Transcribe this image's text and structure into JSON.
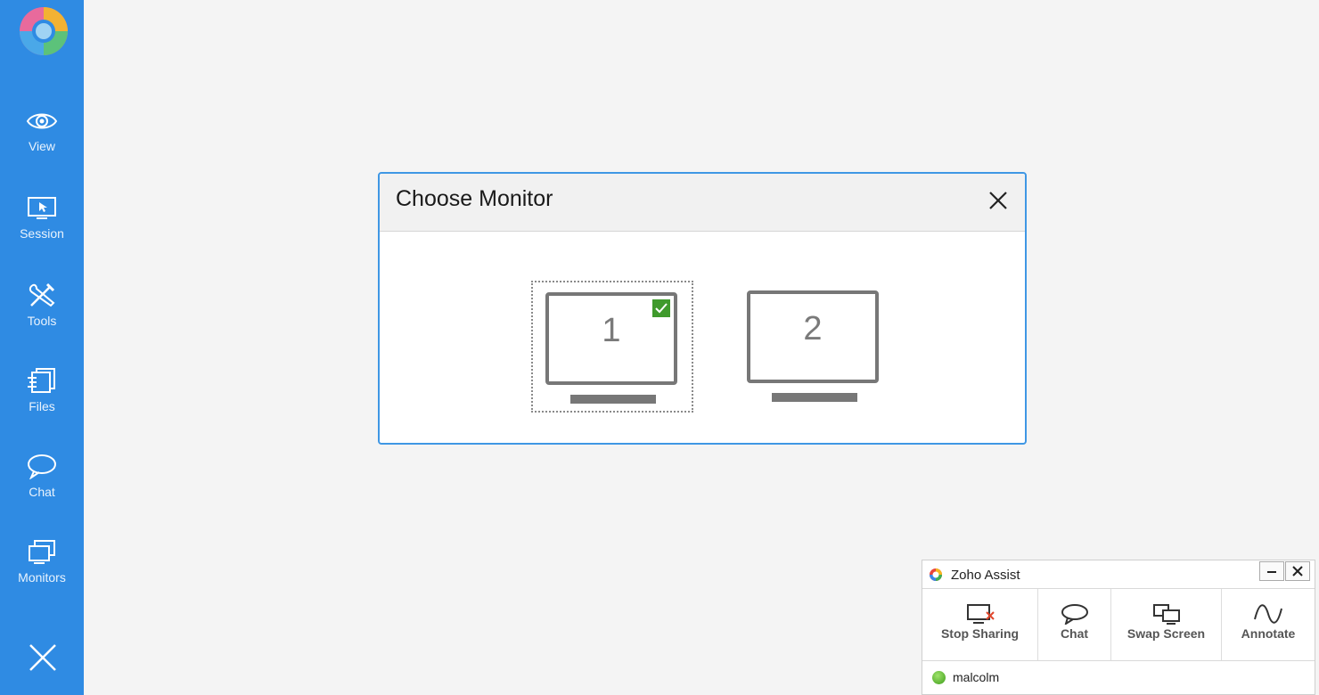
{
  "sidebar": {
    "items": [
      {
        "label": "View",
        "icon": "eye-icon"
      },
      {
        "label": "Session",
        "icon": "monitor-pointer-icon"
      },
      {
        "label": "Tools",
        "icon": "tools-icon"
      },
      {
        "label": "Files",
        "icon": "files-icon"
      },
      {
        "label": "Chat",
        "icon": "chat-bubble-icon"
      },
      {
        "label": "Monitors",
        "icon": "monitors-icon"
      }
    ],
    "close_icon": "close-icon"
  },
  "dialog": {
    "title": "Choose Monitor",
    "monitors": [
      {
        "number": "1",
        "selected": true
      },
      {
        "number": "2",
        "selected": false
      }
    ]
  },
  "assist_panel": {
    "title": "Zoho Assist",
    "buttons": [
      {
        "label": "Stop Sharing",
        "icon": "stop-sharing-icon"
      },
      {
        "label": "Chat",
        "icon": "chat-icon"
      },
      {
        "label": "Swap Screen",
        "icon": "swap-screen-icon"
      },
      {
        "label": "Annotate",
        "icon": "annotate-icon"
      }
    ],
    "user": {
      "name": "malcolm",
      "status": "online"
    }
  },
  "colors": {
    "sidebar": "#2f8be3",
    "dialog_border": "#3f97e4",
    "check_green": "#3f9a2c",
    "status_green": "#3e9d1a"
  }
}
